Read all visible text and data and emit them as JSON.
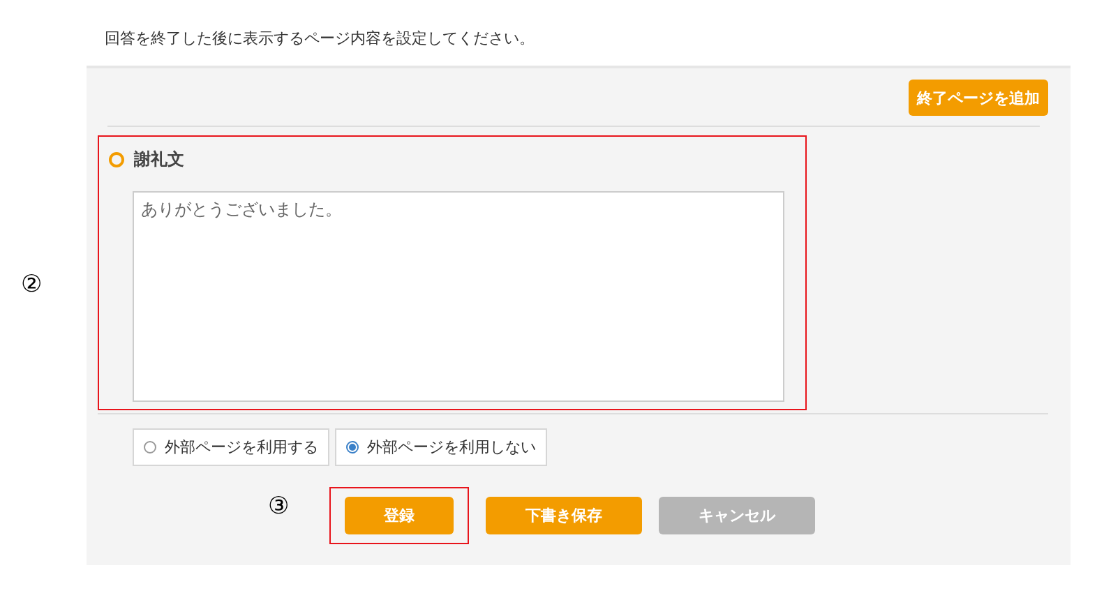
{
  "instruction": "回答を終了した後に表示するページ内容を設定してください。",
  "add_button": {
    "label": "終了ページを追加"
  },
  "section": {
    "title": "謝礼文",
    "value": "ありがとうございました。",
    "annotation": "②"
  },
  "options": [
    {
      "label": "外部ページを利用する",
      "selected": false
    },
    {
      "label": "外部ページを利用しない",
      "selected": true
    }
  ],
  "actions": {
    "annotation": "③",
    "buttons": [
      {
        "label": "登録",
        "disabled": false,
        "highlighted": true
      },
      {
        "label": "下書き保存",
        "disabled": false,
        "highlighted": false
      },
      {
        "label": "キャンセル",
        "disabled": true,
        "highlighted": false
      }
    ]
  }
}
